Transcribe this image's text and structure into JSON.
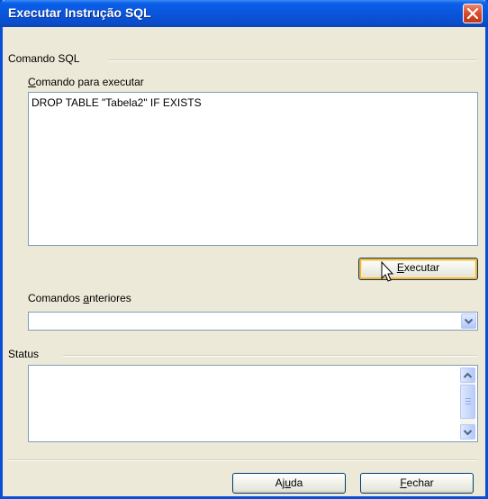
{
  "window": {
    "title": "Executar Instrução SQL"
  },
  "sql_command_group": {
    "group_label": "Comando SQL",
    "command_label": "Comando para executar",
    "command_value": "DROP TABLE \"Tabela2\" IF EXISTS",
    "execute_button": "Executar"
  },
  "previous_commands": {
    "label": "Comandos anteriores",
    "selected_value": ""
  },
  "status": {
    "group_label": "Status",
    "text": ""
  },
  "footer": {
    "help_button": "Ajuda",
    "close_button": "Fechar"
  },
  "icons": {
    "close": "close-icon",
    "dropdown": "chevron-down-icon",
    "scroll_up": "arrow-up-icon",
    "scroll_down": "arrow-down-icon",
    "cursor": "mouse-cursor-icon"
  },
  "colors": {
    "titlebar": "#0a55dc",
    "dialog_bg": "#ece9d8",
    "close_button": "#d94a2a",
    "focus_ring": "#f8b330"
  }
}
